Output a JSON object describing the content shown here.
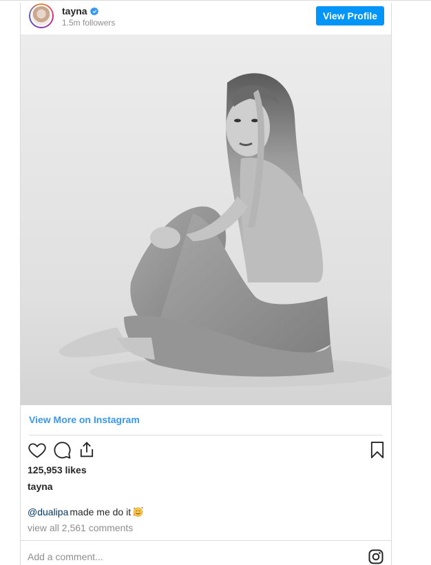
{
  "header": {
    "username": "tayna",
    "followers": "1.5m followers",
    "view_profile_label": "View Profile",
    "verified_icon": "verified-badge-icon"
  },
  "post": {
    "photo_description_icon": "photo-image",
    "view_more_label": "View More on Instagram",
    "likes": "125,953 likes",
    "caption_user": "tayna",
    "mention": "@dualipa",
    "caption_text": " made me do it",
    "caption_emoji": "smiling-face-with-hearts-emoji",
    "view_comments": "view all 2,561 comments",
    "add_comment_placeholder": "Add a comment..."
  },
  "icons": {
    "like": "heart-icon",
    "comment": "comment-bubble-icon",
    "share": "share-icon",
    "save": "bookmark-icon",
    "brand": "instagram-logo-icon"
  },
  "colors": {
    "primary_button": "#0095f6",
    "link_blue": "#3897f0",
    "text_primary": "#262626",
    "text_secondary": "#8e8e8e",
    "border": "#dbdbdb"
  }
}
